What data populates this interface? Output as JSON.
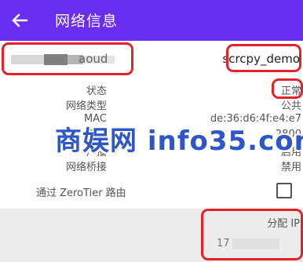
{
  "header": {
    "title": "网络信息"
  },
  "network": {
    "name_visible": "aoud",
    "network_name": "scrcpy_demo"
  },
  "info_rows": [
    {
      "label": "状态",
      "value": "正常"
    },
    {
      "label": "网络类型",
      "value": "公共"
    },
    {
      "label": "MAC",
      "value": "de:36:d6:4f:e4:e7"
    },
    {
      "label": "MTU",
      "value": "2800"
    },
    {
      "label": "广播",
      "value": "启用"
    },
    {
      "label": "网络桥接",
      "value": "禁用"
    }
  ],
  "route": {
    "label": "通过 ZeroTier 路由",
    "checked": false
  },
  "ip_section": {
    "header": "分配 IP",
    "value": "17      /16"
  },
  "watermark": "商娱网 info35.com",
  "colors": {
    "app_bar": "#6a2df2",
    "annotation": "#e3222a",
    "watermark": "#2f56c8",
    "ip_panel": "#ececec"
  }
}
